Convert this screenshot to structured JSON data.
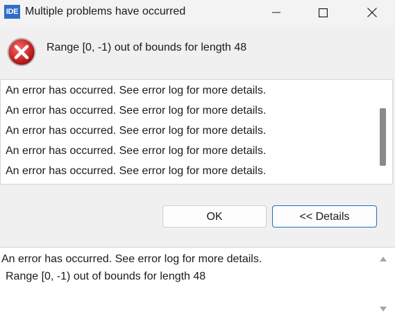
{
  "window": {
    "app_icon_label": "IDE",
    "title": "Multiple problems have occurred"
  },
  "message": {
    "icon": "error-icon",
    "text": "Range [0, -1) out of bounds for length 48"
  },
  "problems": [
    "An error has occurred. See error log for more details.",
    "An error has occurred. See error log for more details.",
    "An error has occurred. See error log for more details.",
    "An error has occurred. See error log for more details.",
    "An error has occurred. See error log for more details."
  ],
  "buttons": {
    "ok": "OK",
    "details": "<< Details"
  },
  "details": {
    "line1": "An error has occurred. See error log for more details.",
    "line2": "Range [0, -1) out of bounds for length 48"
  },
  "colors": {
    "accent": "#1f6fbf",
    "error_red": "#d32f2f",
    "app_icon_bg": "#2f6ec6"
  }
}
